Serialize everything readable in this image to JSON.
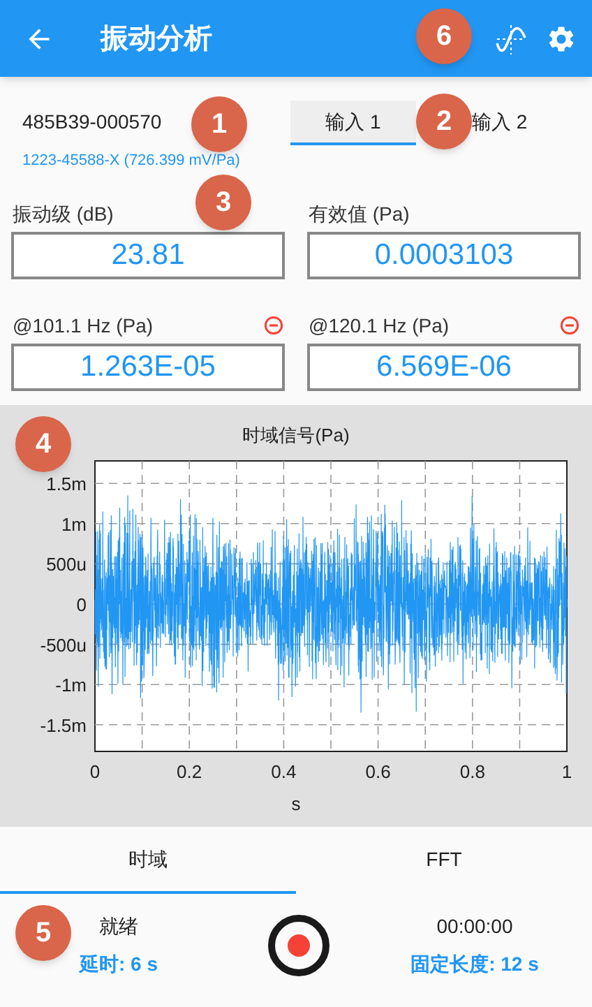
{
  "app_bar": {
    "title": "振动分析"
  },
  "sensor": {
    "id": "485B39-000570",
    "detail": "1223-45588-X (726.399 mV/Pa)"
  },
  "input_tabs": [
    {
      "label": "输入 1",
      "selected": true
    },
    {
      "label": "输入 2",
      "selected": false
    }
  ],
  "measurements": [
    {
      "label": "振动级 (dB)",
      "value": "23.81",
      "removable": false
    },
    {
      "label": "有效值 (Pa)",
      "value": "0.0003103",
      "removable": false
    },
    {
      "label": "@101.1 Hz (Pa)",
      "value": "1.263E-05",
      "removable": true
    },
    {
      "label": "@120.1 Hz (Pa)",
      "value": "6.569E-06",
      "removable": true
    }
  ],
  "chart": {
    "title": "时域信号(Pa)",
    "xlabel": "s",
    "yticks": [
      "1.5m",
      "1m",
      "500u",
      "0",
      "-500u",
      "-1m",
      "-1.5m"
    ],
    "xticks": [
      "0",
      "0.2",
      "0.4",
      "0.6",
      "0.8",
      "1"
    ]
  },
  "view_tabs": [
    {
      "label": "时域",
      "selected": true
    },
    {
      "label": "FFT",
      "selected": false
    }
  ],
  "status": {
    "state": "就绪",
    "delay": "延时: 6 s",
    "timer": "00:00:00",
    "length": "固定长度: 12 s"
  },
  "callouts": [
    "6",
    "1",
    "2",
    "3",
    "4",
    "5"
  ]
}
